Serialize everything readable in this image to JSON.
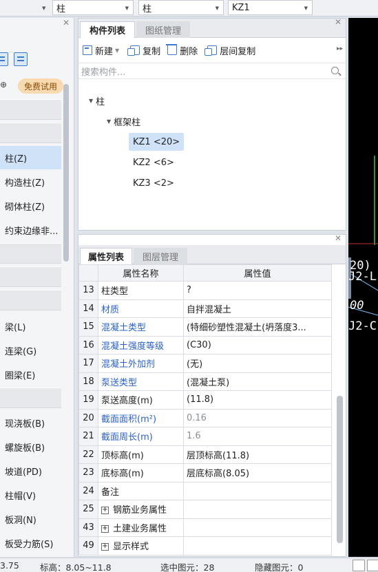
{
  "topbar": {
    "dd1_value": "柱",
    "dd2_value": "柱",
    "dd3_value": "KZ1"
  },
  "left_panel": {
    "trial_badge": "免费试用",
    "items": [
      {
        "label": "柱(Z)"
      },
      {
        "label": "构造柱(Z)"
      },
      {
        "label": "砌体柱(Z)"
      },
      {
        "label": "约束边缘非..."
      },
      {
        "label": "梁(L)"
      },
      {
        "label": "连梁(G)"
      },
      {
        "label": "圈梁(E)"
      },
      {
        "label": "现浇板(B)"
      },
      {
        "label": "螺旋板(B)"
      },
      {
        "label": "坡道(PD)"
      },
      {
        "label": "柱帽(V)"
      },
      {
        "label": "板洞(N)"
      },
      {
        "label": "板受力筋(S)"
      }
    ]
  },
  "component_panel": {
    "tab_active": "构件列表",
    "tab_inactive": "图纸管理",
    "toolbar": {
      "new_label": "新建",
      "copy_label": "复制",
      "delete_label": "删除",
      "floor_copy_label": "层间复制"
    },
    "search_placeholder": "搜索构件...",
    "tree": {
      "root": "柱",
      "group": "框架柱",
      "items": [
        "KZ1 <20>",
        "KZ2 <6>",
        "KZ3 <2>"
      ]
    }
  },
  "property_panel": {
    "tab_active": "属性列表",
    "tab_inactive": "图层管理",
    "col_name": "属性名称",
    "col_value": "属性值",
    "rows": [
      {
        "num": "13",
        "name": "柱类型",
        "value": "?",
        "name_style": "normal",
        "value_style": "normal"
      },
      {
        "num": "14",
        "name": "材质",
        "value": "自拌混凝土",
        "name_style": "blue",
        "value_style": "normal"
      },
      {
        "num": "15",
        "name": "混凝土类型",
        "value": "(特细砂塑性混凝土(坍落度3...",
        "name_style": "blue",
        "value_style": "normal"
      },
      {
        "num": "16",
        "name": "混凝土强度等级",
        "value": "(C30)",
        "name_style": "blue",
        "value_style": "normal"
      },
      {
        "num": "17",
        "name": "混凝土外加剂",
        "value": "(无)",
        "name_style": "blue",
        "value_style": "normal"
      },
      {
        "num": "18",
        "name": "泵送类型",
        "value": "(混凝土泵)",
        "name_style": "blue",
        "value_style": "normal"
      },
      {
        "num": "19",
        "name": "泵送高度(m)",
        "value": "(11.8)",
        "name_style": "normal",
        "value_style": "normal"
      },
      {
        "num": "20",
        "name": "截面面积(m²)",
        "value": "0.16",
        "name_style": "blue",
        "value_style": "gray"
      },
      {
        "num": "21",
        "name": "截面周长(m)",
        "value": "1.6",
        "name_style": "blue",
        "value_style": "gray"
      },
      {
        "num": "22",
        "name": "顶标高(m)",
        "value": "层顶标高(11.8)",
        "name_style": "normal",
        "value_style": "normal"
      },
      {
        "num": "23",
        "name": "底标高(m)",
        "value": "层底标高(8.05)",
        "name_style": "normal",
        "value_style": "normal"
      },
      {
        "num": "24",
        "name": "备注",
        "value": "",
        "name_style": "normal",
        "value_style": "normal"
      },
      {
        "num": "25",
        "name": "钢筋业务属性",
        "value": "",
        "name_style": "expand",
        "value_style": "normal"
      },
      {
        "num": "43",
        "name": "土建业务属性",
        "value": "",
        "name_style": "expand",
        "value_style": "normal"
      },
      {
        "num": "49",
        "name": "显示样式",
        "value": "",
        "name_style": "expand",
        "value_style": "normal"
      }
    ]
  },
  "canvas": {
    "texts": [
      "20)",
      "J2-L",
      "00",
      "J2-C"
    ]
  },
  "statusbar": {
    "coord": "3.75",
    "elevation": "标高：8.05~11.8",
    "selected": "选中图元：28",
    "hidden": "隐藏图元：0"
  },
  "colors": {
    "accent": "#3b7ad0",
    "link_blue": "#2b62c8",
    "selection": "#cfe2f8",
    "trial_badge": "#f8d9b0"
  }
}
